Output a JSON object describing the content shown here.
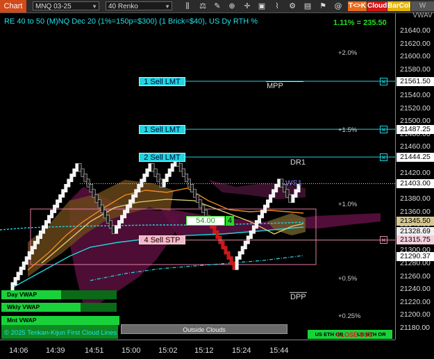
{
  "toolbar": {
    "chart_label": "Chart",
    "instrument": "MNQ 03-25",
    "bar_type": "40 Renko",
    "btn_tk": "T<>K",
    "btn_cloud": "Cloud",
    "btn_barcol": "BarCol",
    "btn_vwave": "W VWAV",
    "icons": [
      "bar-style-icon",
      "chart-style-icon",
      "drawing-tool-icon",
      "zoom-in-icon",
      "zoom-out-icon",
      "crosshair-icon",
      "data-box-icon",
      "indicators-icon",
      "strategies-icon",
      "templates-icon",
      "properties-icon",
      "at-icon"
    ],
    "colors": {
      "chart_tab": "#d04a1a",
      "tk": "#e86a1c",
      "cloud": "#d01818",
      "barcol": "#e4b40a"
    }
  },
  "chart": {
    "title": "RE 40 to 50 (M)NQ Dec 20 (1%=150p=$300) (1 Brick=$40), US Dy RTH %",
    "pct_readout": "1.11% = 235.50",
    "copyright": "© 2025 Tenkan-Kijun First Cloud Lines",
    "price_axis": [
      {
        "label": "21640.00",
        "p": 21640
      },
      {
        "label": "21620.00",
        "p": 21620
      },
      {
        "label": "21600.00",
        "p": 21600
      },
      {
        "label": "21580.00",
        "p": 21580
      },
      {
        "label": "21540.00",
        "p": 21540
      },
      {
        "label": "21520.00",
        "p": 21520
      },
      {
        "label": "21500.00",
        "p": 21500
      },
      {
        "label": "21480.00",
        "p": 21480
      },
      {
        "label": "21460.00",
        "p": 21460
      },
      {
        "label": "21440.00",
        "p": 21440
      },
      {
        "label": "21420.00",
        "p": 21420
      },
      {
        "label": "21380.00",
        "p": 21380
      },
      {
        "label": "21360.00",
        "p": 21360
      },
      {
        "label": "21340.00",
        "p": 21340
      },
      {
        "label": "21300.00",
        "p": 21300
      },
      {
        "label": "21280.00",
        "p": 21280
      },
      {
        "label": "21260.00",
        "p": 21260
      },
      {
        "label": "21240.00",
        "p": 21240
      },
      {
        "label": "21220.00",
        "p": 21220
      },
      {
        "label": "21200.00",
        "p": 21200
      },
      {
        "label": "21180.00",
        "p": 21180
      }
    ],
    "price_boxes": [
      {
        "label": "21561.50",
        "p": 21561.5,
        "bg": "#ffffff"
      },
      {
        "label": "21487.25",
        "p": 21487.25,
        "bg": "#ffffff"
      },
      {
        "label": "21444.25",
        "p": 21444.25,
        "bg": "#ffffff"
      },
      {
        "label": "21403.00",
        "p": 21403,
        "bg": "#ffffff"
      },
      {
        "label": "21345.50",
        "p": 21345.5,
        "bg": "#d8c890"
      },
      {
        "label": "21328.69",
        "p": 21328.69,
        "bg": "#f0f0f0"
      },
      {
        "label": "21315.75",
        "p": 21315.75,
        "bg": "#f4d0dc"
      },
      {
        "label": "21290.37",
        "p": 21290.37,
        "bg": "#ffffff"
      }
    ],
    "time_axis": [
      {
        "label": "14:06",
        "i": 0
      },
      {
        "label": "14:39",
        "i": 1
      },
      {
        "label": "14:51",
        "i": 2
      },
      {
        "label": "15:00",
        "i": 3
      },
      {
        "label": "15:02",
        "i": 4
      },
      {
        "label": "15:12",
        "i": 5
      },
      {
        "label": "15:24",
        "i": 6
      },
      {
        "label": "15:44",
        "i": 7
      }
    ],
    "orders": [
      {
        "label": "1 Sell LMT",
        "p": 21561.5,
        "kind": "limit"
      },
      {
        "label": "1 Sell LMT",
        "p": 21487.25,
        "kind": "limit"
      },
      {
        "label": "2 Sell LMT",
        "p": 21444.25,
        "kind": "limit"
      },
      {
        "label": "4 Sell STP",
        "p": 21315.75,
        "kind": "stop"
      }
    ],
    "position": {
      "price": "54.00",
      "qty": "4"
    },
    "pct_levels": [
      {
        "label": "+2.0%",
        "p": 21605
      },
      {
        "label": "+1.5%",
        "p": 21485
      },
      {
        "label": "+1.0%",
        "p": 21370
      },
      {
        "label": "+0.5%",
        "p": 21255
      },
      {
        "label": "+0.25%",
        "p": 21197
      }
    ],
    "pivots": [
      {
        "label": "MPP",
        "p": 21554
      },
      {
        "label": "DR1",
        "p": 21436
      },
      {
        "label": "WS1",
        "p": 21404
      },
      {
        "label": "DPP",
        "p": 21227
      }
    ],
    "vwap_labels": [
      {
        "label": "Day VWAP",
        "w": 86
      },
      {
        "label": "Wkly VWAP",
        "w": 114
      },
      {
        "label": "Mnt VWAP",
        "w": 170
      }
    ],
    "outside_clouds": "Outside Clouds",
    "bottom_right": [
      "US ETH OR",
      "US RTH OR"
    ],
    "close_label": "CLOSE OSE"
  }
}
